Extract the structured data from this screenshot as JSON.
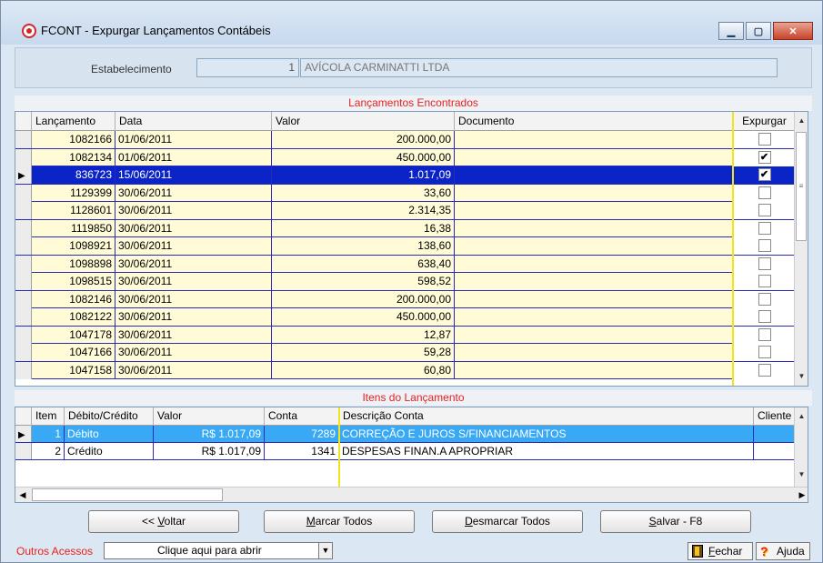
{
  "window": {
    "title": "FCONT - Expurgar Lançamentos Contábeis",
    "min_icon": "minimize-icon",
    "max_icon": "maximize-icon",
    "close_icon": "close-icon"
  },
  "header": {
    "estab_label": "Estabelecimento",
    "estab_code": "1",
    "estab_name": "AVÍCOLA CARMINATTI LTDA"
  },
  "section1_title": "Lançamentos Encontrados",
  "grid1": {
    "columns": [
      "Lançamento",
      "Data",
      "Valor",
      "Documento",
      "Expurgar"
    ],
    "rows": [
      {
        "lanc": "1082166",
        "data": "01/06/2011",
        "valor": "200.000,00",
        "doc": "",
        "exp": ""
      },
      {
        "lanc": "1082134",
        "data": "01/06/2011",
        "valor": "450.000,00",
        "doc": "",
        "exp": "✔"
      },
      {
        "lanc": "836723",
        "data": "15/06/2011",
        "valor": "1.017,09",
        "doc": "",
        "exp": "✔"
      },
      {
        "lanc": "1129399",
        "data": "30/06/2011",
        "valor": "33,60",
        "doc": "",
        "exp": ""
      },
      {
        "lanc": "1128601",
        "data": "30/06/2011",
        "valor": "2.314,35",
        "doc": "",
        "exp": ""
      },
      {
        "lanc": "1119850",
        "data": "30/06/2011",
        "valor": "16,38",
        "doc": "",
        "exp": ""
      },
      {
        "lanc": "1098921",
        "data": "30/06/2011",
        "valor": "138,60",
        "doc": "",
        "exp": ""
      },
      {
        "lanc": "1098898",
        "data": "30/06/2011",
        "valor": "638,40",
        "doc": "",
        "exp": ""
      },
      {
        "lanc": "1098515",
        "data": "30/06/2011",
        "valor": "598,52",
        "doc": "",
        "exp": ""
      },
      {
        "lanc": "1082146",
        "data": "30/06/2011",
        "valor": "200.000,00",
        "doc": "",
        "exp": ""
      },
      {
        "lanc": "1082122",
        "data": "30/06/2011",
        "valor": "450.000,00",
        "doc": "",
        "exp": ""
      },
      {
        "lanc": "1047178",
        "data": "30/06/2011",
        "valor": "12,87",
        "doc": "",
        "exp": ""
      },
      {
        "lanc": "1047166",
        "data": "30/06/2011",
        "valor": "59,28",
        "doc": "",
        "exp": ""
      },
      {
        "lanc": "1047158",
        "data": "30/06/2011",
        "valor": "60,80",
        "doc": "",
        "exp": ""
      }
    ],
    "selected_index": 2
  },
  "section2_title": "Itens do Lançamento",
  "grid2": {
    "columns": [
      "Item",
      "Débito/Crédito",
      "Valor",
      "Conta",
      "Descrição Conta",
      "Cliente"
    ],
    "rows": [
      {
        "item": "1",
        "dc": "Débito",
        "valor": "R$ 1.017,09",
        "conta": "7289",
        "desc": "CORREÇÃO E JUROS S/FINANCIAMENTOS",
        "cli": ""
      },
      {
        "item": "2",
        "dc": "Crédito",
        "valor": "R$ 1.017,09",
        "conta": "1341",
        "desc": "DESPESAS FINAN.A APROPRIAR",
        "cli": ""
      }
    ],
    "selected_index": 0
  },
  "buttons": {
    "voltar_pre": "<< ",
    "voltar_u": "V",
    "voltar_post": "oltar",
    "marcar_u": "M",
    "marcar_post": "arcar Todos",
    "desmarcar_u": "D",
    "desmarcar_post": "esmarcar Todos",
    "salvar_u": "S",
    "salvar_post": "alvar - F8"
  },
  "bottom": {
    "outros_label": "Outros Acessos",
    "combo_value": "Clique aqui para abrir",
    "fechar_u": "F",
    "fechar_post": "echar",
    "ajuda_label": "Ajuda"
  },
  "colors": {
    "selected_row": "#0a24c7",
    "selected_item": "#39a8f5",
    "section_title": "#e8211d",
    "row_bg": "#fffbd6"
  }
}
